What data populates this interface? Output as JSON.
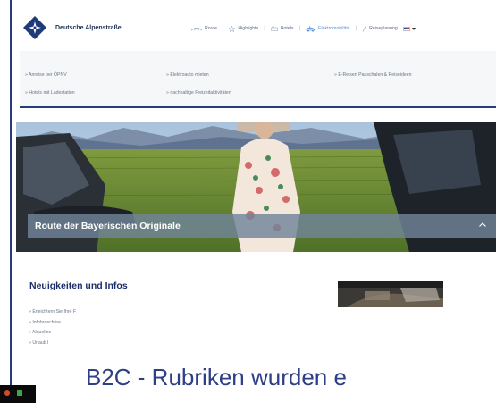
{
  "brand": {
    "name": "Deutsche Alpenstraße"
  },
  "nav": {
    "items": [
      {
        "label": "Route",
        "icon": "road-icon"
      },
      {
        "label": "Highlights",
        "icon": "star-icon"
      },
      {
        "label": "Hotels",
        "icon": "hotel-icon"
      },
      {
        "label": "Elektromobilität",
        "icon": "electric-car-icon"
      },
      {
        "label": "Reiseplanung",
        "icon": "pen-icon"
      }
    ],
    "language_dropdown": {
      "icon": "flag-icon"
    }
  },
  "submenu": {
    "links": [
      "» Anreise per ÖPNV",
      "» Elektroauto mieten",
      "» E-Reisen Pauschalen & Reiseideen",
      "» Hotels mit Ladestation",
      "» nachhaltige Freizeitaktivitäten"
    ]
  },
  "hero": {
    "title": "Route der Bayerischen Originale"
  },
  "news": {
    "title": "Neuigkeiten und Infos",
    "items": [
      "» Erleichtern Sie Ihre F",
      "» Infobroschüre",
      "» Aktuelles",
      "» Urlaub I"
    ]
  },
  "slide": {
    "text": "B2C - Rubriken wurden e"
  },
  "colors": {
    "accent": "#2b3a78",
    "link": "#6a7686",
    "heading": "#1b2e6a",
    "caption_bg": "#708498"
  }
}
